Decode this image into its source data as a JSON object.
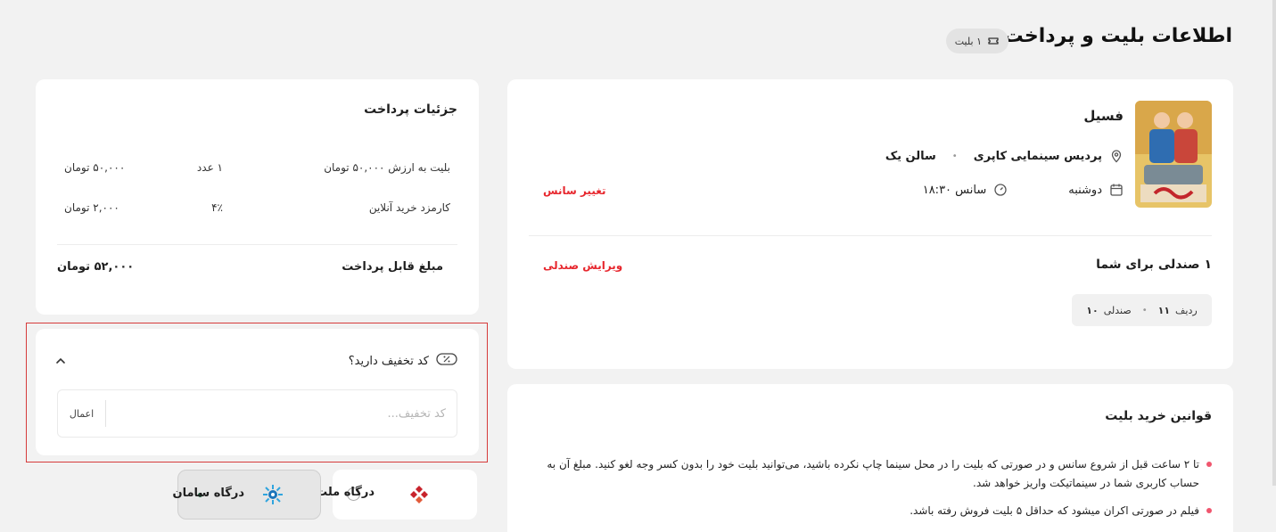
{
  "header": {
    "title": "اطلاعات بلیت و پرداخت",
    "ticket_badge": "۱ بلیت"
  },
  "movie": {
    "title": "فسیل",
    "cinema": "پردیس سینمایی کاپری",
    "hall": "سالن یک",
    "day": "دوشنبه",
    "session": "سانس ۱۸:۳۰",
    "change_session_label": "تغییر سانس",
    "poster_icon": "movie-poster"
  },
  "seats": {
    "title": "۱ صندلی برای شما",
    "edit_label": "ویرایش صندلی",
    "row_label": "ردیف",
    "row_value": "۱۱",
    "seat_label": "صندلی",
    "seat_value": "۱۰"
  },
  "rules": {
    "title": "قوانین خرید بلیت",
    "items": [
      "تا ۲ ساعت قبل از شروع سانس و در صورتی که بلیت را در محل سینما چاپ نکرده باشید، می‌توانید بلیت خود را بدون کسر وجه لغو کنید. مبلغ آن به حساب کاربری شما در سینماتیکت واریز خواهد شد.",
      "فیلم در صورتی اکران میشود که حداقل ۵ بلیت فروش رفته باشد."
    ]
  },
  "payment": {
    "title": "جزئیات پرداخت",
    "rows": [
      {
        "label": "بلیت به ارزش ۵۰,۰۰۰ تومان",
        "qty": "۱ عدد",
        "amount": "۵۰,۰۰۰ تومان"
      },
      {
        "label": "کارمزد خرید آنلاین",
        "qty": "۴٪",
        "amount": "۲,۰۰۰ تومان"
      }
    ],
    "total_label": "مبلغ قابل پرداخت",
    "total_amount": "۵۲,۰۰۰ تومان"
  },
  "discount": {
    "question": "کد تخفیف دارید؟",
    "placeholder": "کد تخفیف...",
    "apply_label": "اعمال"
  },
  "gateways": [
    {
      "name": "درگاه ملت",
      "selected": false,
      "icon": "mellat-logo"
    },
    {
      "name": "درگاه سامان",
      "selected": true,
      "icon": "saman-logo"
    }
  ],
  "colors": {
    "accent_red": "#e7272e",
    "bullet_pink": "#f0566e",
    "highlight_border": "#d63b3b",
    "page_bg": "#f2f2f2"
  }
}
